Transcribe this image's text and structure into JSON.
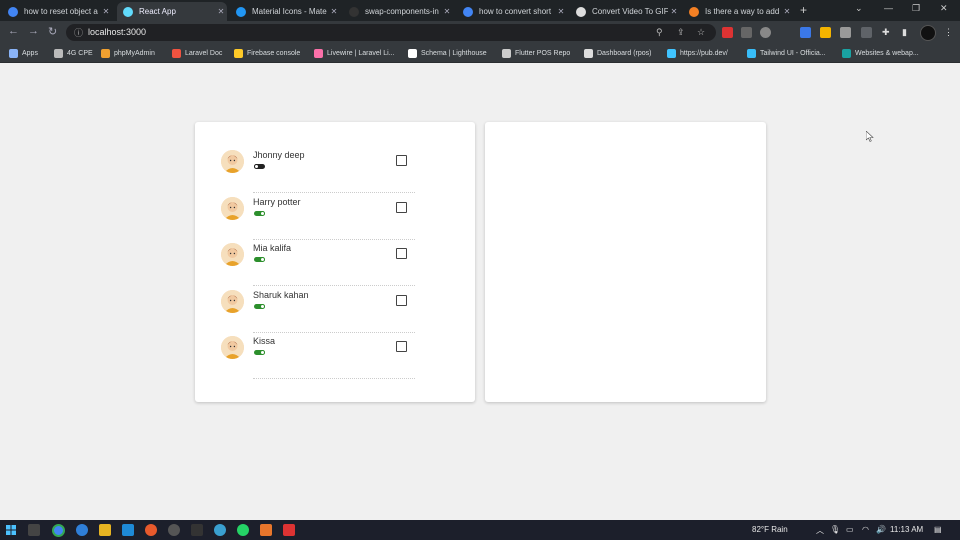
{
  "browser": {
    "tabs": [
      {
        "title": "how to reset object a",
        "favicon": "google-icon",
        "color": "#4285f4"
      },
      {
        "title": "React App",
        "favicon": "react-icon",
        "color": "#61dafb"
      },
      {
        "title": "Material Icons - Mate",
        "favicon": "mui-icon",
        "color": "#2196f3"
      },
      {
        "title": "swap-components-in",
        "favicon": "github-icon",
        "color": "#333333"
      },
      {
        "title": "how to convert short",
        "favicon": "google-icon",
        "color": "#4285f4"
      },
      {
        "title": "Convert Video To GIF",
        "favicon": "globe-icon",
        "color": "#dddddd"
      },
      {
        "title": "Is there a way to add",
        "favicon": "stackoverflow-icon",
        "color": "#f48024"
      }
    ],
    "url": "localhost:3000",
    "bookmarks": [
      {
        "label": "Apps",
        "icon": "apps-grid-icon",
        "color": "#8ab4f8"
      },
      {
        "label": "4G CPE",
        "icon": "globe-icon",
        "color": "#bbbbbb"
      },
      {
        "label": "phpMyAdmin",
        "icon": "phpmyadmin-icon",
        "color": "#f0a030"
      },
      {
        "label": "Laravel Doc",
        "icon": "laravel-icon",
        "color": "#f05340"
      },
      {
        "label": "Firebase console",
        "icon": "firebase-icon",
        "color": "#ffca28"
      },
      {
        "label": "Livewire | Laravel Li...",
        "icon": "livewire-icon",
        "color": "#fb70a9"
      },
      {
        "label": "Schema | Lighthouse",
        "icon": "lighthouse-icon",
        "color": "#ffffff"
      },
      {
        "label": "Flutter POS Repo",
        "icon": "github-icon",
        "color": "#cccccc"
      },
      {
        "label": "Dashboard (rpos)",
        "icon": "stack-icon",
        "color": "#dddddd"
      },
      {
        "label": "https://pub.dev/",
        "icon": "dart-icon",
        "color": "#40c4ff"
      },
      {
        "label": "Tailwind UI - Officia...",
        "icon": "tailwind-icon",
        "color": "#38bdf8"
      },
      {
        "label": "Websites & webap...",
        "icon": "dollar-icon",
        "color": "#1aa3a3"
      }
    ]
  },
  "people": [
    {
      "name": "Jhonny deep",
      "active": false,
      "checked": false
    },
    {
      "name": "Harry potter",
      "active": true,
      "checked": false
    },
    {
      "name": "Mia kalifa",
      "active": true,
      "checked": false
    },
    {
      "name": "Sharuk kahan",
      "active": true,
      "checked": false
    },
    {
      "name": "Kissa",
      "active": true,
      "checked": false
    }
  ],
  "taskbar": {
    "weather": "82°F  Rain",
    "time": "11:13 AM"
  }
}
